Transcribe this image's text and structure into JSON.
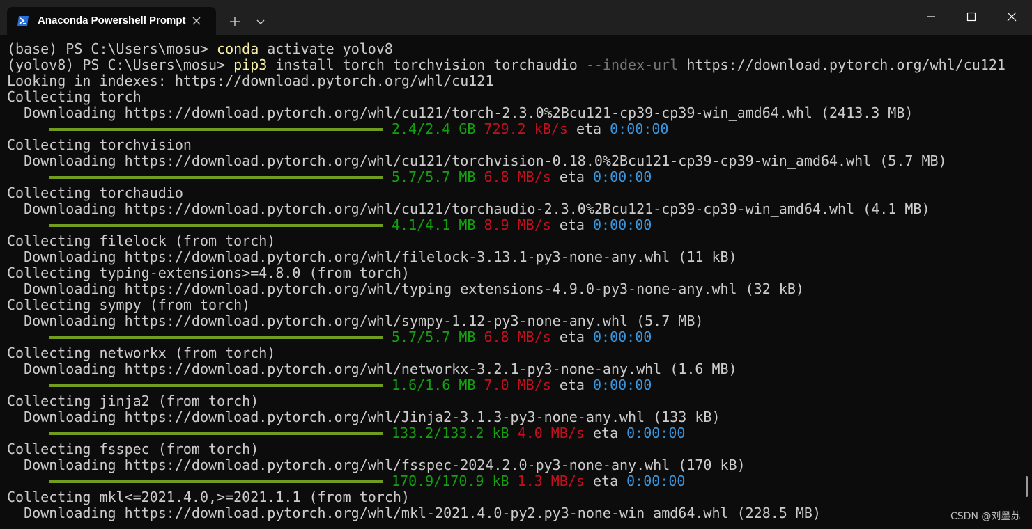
{
  "titlebar": {
    "tab_title": "Anaconda Powershell Prompt",
    "tab_icon": "powershell-icon",
    "close_tab_icon": "close-icon",
    "new_tab_icon": "plus-icon",
    "dropdown_icon": "chevron-down-icon",
    "window_controls": [
      "minimize-icon",
      "maximize-icon",
      "close-icon"
    ]
  },
  "colors": {
    "background": "#0c0c0c",
    "titlebar": "#202020",
    "text": "#cccccc",
    "command": "#f9f1a5",
    "flag": "#767676",
    "green": "#13a10e",
    "red": "#c50f1f",
    "blue": "#3a96dd",
    "progress": "#729c1f"
  },
  "terminal": {
    "line1": {
      "prompt": "(base) PS C:\\Users\\mosu> ",
      "cmd": "conda",
      "rest": " activate yolov8"
    },
    "line2": {
      "prompt": "(yolov8) PS C:\\Users\\mosu> ",
      "cmd": "pip3",
      "rest": " install torch torchvision torchaudio ",
      "flag": "--index-url",
      "url": " https://download.pytorch.org/whl/cu121"
    },
    "line3": "Looking in indexes: https://download.pytorch.org/whl/cu121",
    "line4": "Collecting torch",
    "line5": "  Downloading https://download.pytorch.org/whl/cu121/torch-2.3.0%2Bcu121-cp39-cp39-win_amd64.whl (2413.3 MB)",
    "p1": {
      "size": "2.4/2.4 GB",
      "speed": "729.2 kB/s",
      "eta_label": "eta",
      "eta": "0:00:00"
    },
    "line7": "Collecting torchvision",
    "line8": "  Downloading https://download.pytorch.org/whl/cu121/torchvision-0.18.0%2Bcu121-cp39-cp39-win_amd64.whl (5.7 MB)",
    "p2": {
      "size": "5.7/5.7 MB",
      "speed": "6.8 MB/s",
      "eta_label": "eta",
      "eta": "0:00:00"
    },
    "line10": "Collecting torchaudio",
    "line11": "  Downloading https://download.pytorch.org/whl/cu121/torchaudio-2.3.0%2Bcu121-cp39-cp39-win_amd64.whl (4.1 MB)",
    "p3": {
      "size": "4.1/4.1 MB",
      "speed": "8.9 MB/s",
      "eta_label": "eta",
      "eta": "0:00:00"
    },
    "line13": "Collecting filelock (from torch)",
    "line14": "  Downloading https://download.pytorch.org/whl/filelock-3.13.1-py3-none-any.whl (11 kB)",
    "line15": "Collecting typing-extensions>=4.8.0 (from torch)",
    "line16": "  Downloading https://download.pytorch.org/whl/typing_extensions-4.9.0-py3-none-any.whl (32 kB)",
    "line17": "Collecting sympy (from torch)",
    "line18": "  Downloading https://download.pytorch.org/whl/sympy-1.12-py3-none-any.whl (5.7 MB)",
    "p4": {
      "size": "5.7/5.7 MB",
      "speed": "6.8 MB/s",
      "eta_label": "eta",
      "eta": "0:00:00"
    },
    "line20": "Collecting networkx (from torch)",
    "line21": "  Downloading https://download.pytorch.org/whl/networkx-3.2.1-py3-none-any.whl (1.6 MB)",
    "p5": {
      "size": "1.6/1.6 MB",
      "speed": "7.0 MB/s",
      "eta_label": "eta",
      "eta": "0:00:00"
    },
    "line23": "Collecting jinja2 (from torch)",
    "line24": "  Downloading https://download.pytorch.org/whl/Jinja2-3.1.3-py3-none-any.whl (133 kB)",
    "p6": {
      "size": "133.2/133.2 kB",
      "speed": "4.0 MB/s",
      "eta_label": "eta",
      "eta": "0:00:00"
    },
    "line26": "Collecting fsspec (from torch)",
    "line27": "  Downloading https://download.pytorch.org/whl/fsspec-2024.2.0-py3-none-any.whl (170 kB)",
    "p7": {
      "size": "170.9/170.9 kB",
      "speed": "1.3 MB/s",
      "eta_label": "eta",
      "eta": "0:00:00"
    },
    "line29": "Collecting mkl<=2021.4.0,>=2021.1.1 (from torch)",
    "line30": "  Downloading https://download.pytorch.org/whl/mkl-2021.4.0-py2.py3-none-win_amd64.whl (228.5 MB)"
  },
  "watermark": "CSDN @刘墨苏"
}
